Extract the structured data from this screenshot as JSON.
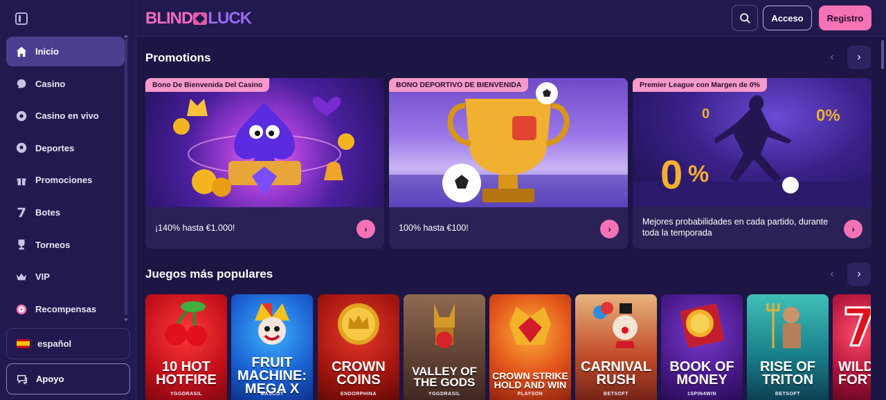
{
  "header": {
    "logo_part1": "BLIND",
    "logo_part2": "LUCK",
    "login_label": "Acceso",
    "register_label": "Registro"
  },
  "sidebar": {
    "items": [
      {
        "label": "Inicio",
        "icon": "home-icon"
      },
      {
        "label": "Casino",
        "icon": "casino-icon"
      },
      {
        "label": "Casino en vivo",
        "icon": "roulette-icon"
      },
      {
        "label": "Deportes",
        "icon": "soccer-ball-icon"
      },
      {
        "label": "Promociones",
        "icon": "gift-icon"
      },
      {
        "label": "Botes",
        "icon": "seven-icon"
      },
      {
        "label": "Torneos",
        "icon": "trophy-icon"
      },
      {
        "label": "VIP",
        "icon": "crown-icon"
      },
      {
        "label": "Recompensas",
        "icon": "target-icon"
      }
    ],
    "language": "español",
    "support": "Apoyo"
  },
  "promotions": {
    "title": "Promotions",
    "cards": [
      {
        "badge": "Bono De Bienvenida Del Casino",
        "text": "¡140% hasta €1.000!"
      },
      {
        "badge": "BONO DEPORTIVO DE BIENVENIDA",
        "text": "100% hasta €100!"
      },
      {
        "badge": "Premier League con Margen de 0%",
        "text": "Mejores probabilidades en cada partido, durante toda la temporada"
      }
    ]
  },
  "popular": {
    "title": "Juegos más populares",
    "games": [
      {
        "title": "10 HOT HOTFIRE",
        "provider": "YGGDRASIL"
      },
      {
        "title": "FRUIT MACHINE: MEGA X",
        "provider": "MASCOT"
      },
      {
        "title": "CROWN COINS",
        "provider": "ENDORPHINA"
      },
      {
        "title": "VALLEY OF THE GODS",
        "provider": "YGGDRASIL"
      },
      {
        "title": "CROWN STRIKE HOLD AND WIN",
        "provider": "PLAYSON"
      },
      {
        "title": "CARNIVAL RUSH",
        "provider": "BETSOFT"
      },
      {
        "title": "BOOK OF MONEY",
        "provider": "1SPIN4WIN"
      },
      {
        "title": "RISE OF TRITON",
        "provider": "BETSOFT"
      },
      {
        "title": "WILD FORT",
        "provider": ""
      }
    ]
  },
  "colors": {
    "background": "#1d1543",
    "sidebar": "#221a4e",
    "accent_pink": "#f472b6",
    "active_nav": "#4a3f8f"
  }
}
